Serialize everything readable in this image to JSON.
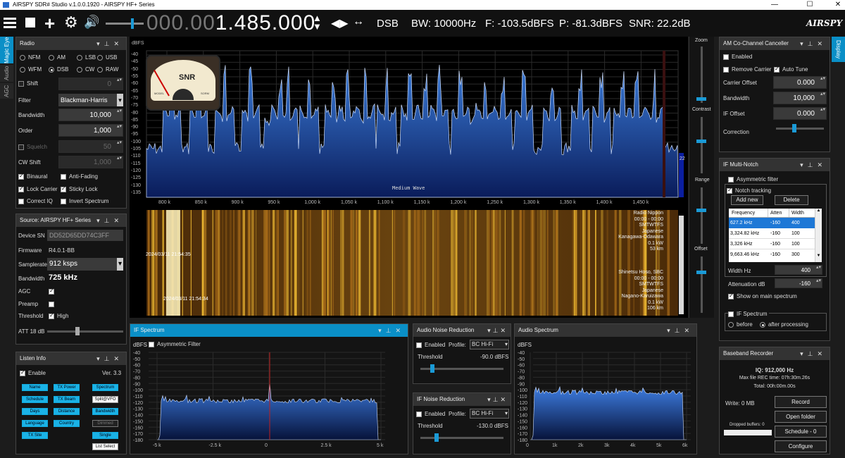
{
  "titlebar": {
    "title": "AIRSPY SDR# Studio v.1.0.0.1920 - AIRSPY HF+ Series",
    "minimize": "—",
    "maximize": "☐",
    "close": "✕"
  },
  "toolbar": {
    "frequency_dim": "000.00",
    "frequency_bright": "1.485.000",
    "mode": "DSB",
    "bw": "BW: 10000Hz",
    "f": "F: -103.5dBFS",
    "p": "P: -81.3dBFS",
    "snr": "SNR: 22.2dB",
    "brand": "AIRSPY"
  },
  "left_tabs": {
    "magic_eye": "Magic Eye",
    "audio": "Audio",
    "agc": "AGC"
  },
  "right_tab": {
    "display": "Display"
  },
  "radio": {
    "title": "Radio",
    "modes": [
      "NFM",
      "AM",
      "LSB",
      "USB",
      "WFM",
      "DSB",
      "CW",
      "RAW"
    ],
    "selected_mode": "DSB",
    "shift_label": "Shift",
    "shift_value": "0",
    "filter_label": "Filter",
    "filter_value": "Blackman-Harris",
    "bandwidth_label": "Bandwidth",
    "bandwidth_value": "10,000",
    "order_label": "Order",
    "order_value": "1,000",
    "squelch_label": "Squelch",
    "squelch_value": "50",
    "cwshift_label": "CW Shift",
    "cwshift_value": "1,000",
    "binaural": "Binaural",
    "anti_fading": "Anti-Fading",
    "lock_carrier": "Lock Carrier",
    "sticky_lock": "Sticky Lock",
    "correct_iq": "Correct IQ",
    "invert_spectrum": "Invert Spectrum"
  },
  "source": {
    "title": "Source: AIRSPY HF+ Series",
    "device_sn_label": "Device SN",
    "device_sn_value": "DD52D65DD74C3FF",
    "firmware_label": "Firmware",
    "firmware_value": "R4.0.1-BB",
    "samplerate_label": "Samplerate",
    "samplerate_value": "912 ksps",
    "bandwidth_label": "Bandwidth",
    "bandwidth_value": "725 kHz",
    "agc_label": "AGC",
    "preamp_label": "Preamp",
    "threshold_label": "Threshold",
    "threshold_value": "High",
    "att_label": "ATT 18 dB"
  },
  "listen": {
    "title": "Listen Info",
    "enable": "Enable",
    "version": "Ver. 3.3",
    "buttons": [
      "Name",
      "TX Power",
      "Spectrum",
      "Schedule",
      "TX Beam",
      "Split@VFO",
      "Days",
      "Distance",
      "Bandwidth",
      "Language",
      "Country",
      "Dimmed",
      "TX Site",
      "",
      "Single",
      "",
      "",
      "List Select"
    ]
  },
  "spectrum": {
    "unit": "dBFS",
    "y_ticks": [
      "-40",
      "-45",
      "-50",
      "-55",
      "-60",
      "-65",
      "-70",
      "-75",
      "-80",
      "-85",
      "-90",
      "-95",
      "-100",
      "-105",
      "-110",
      "-115",
      "-120",
      "-125",
      "-130",
      "-135"
    ],
    "x_ticks": [
      "800 k",
      "850 k",
      "900 k",
      "950 k",
      "1,000 k",
      "1,050 k",
      "1,100 k",
      "1,150 k",
      "1,200 k",
      "1,250 k",
      "1,300 k",
      "1,350 k",
      "1,400 k",
      "1,450 k"
    ],
    "band_label": "Medium Wave",
    "level_value": "22",
    "meter_label": "SNR",
    "meter_left": "MODEL",
    "meter_right": "SORM"
  },
  "waterfall": {
    "ts1": "2024/03/11 21:54:35",
    "ts2": "2024/03/11 21:54:34",
    "station1": [
      "Radio Nippon",
      "00:00 - 00:00",
      "SMTWTFS",
      "Japanese",
      "Kanagawa-Odawara",
      "0.1 kW",
      "53 km"
    ],
    "station2": [
      "Shinetsu Hoso, SBC",
      "00:00 - 00:00",
      "SMTWTFS",
      "Japanese",
      "Nagano-Karuizawa",
      "0.1 kW",
      "106 km"
    ]
  },
  "zoom": {
    "zoom": "Zoom",
    "contrast": "Contrast",
    "range": "Range",
    "offset": "Offset"
  },
  "if_spectrum": {
    "title": "IF Spectrum",
    "asymmetric": "Asymmetric Filter",
    "unit": "dBFS",
    "y_ticks": [
      "-40",
      "-50",
      "-60",
      "-70",
      "-80",
      "-90",
      "-100",
      "-110",
      "-120",
      "-130",
      "-140",
      "-150",
      "-160",
      "-170",
      "-180"
    ],
    "x_ticks": [
      "-5 k",
      "-2.5 k",
      "0",
      "2.5 k",
      "5 k"
    ]
  },
  "audio_nr": {
    "title": "Audio Noise Reduction",
    "enabled": "Enabled",
    "profile_label": "Profile:",
    "profile_value": "BC Hi-Fi",
    "threshold_label": "Threshold",
    "threshold_value": "-90.0 dBFS"
  },
  "if_nr": {
    "title": "IF Noise Reduction",
    "enabled": "Enabled",
    "profile_label": "Profile:",
    "profile_value": "BC Hi-Fi",
    "threshold_label": "Threshold",
    "threshold_value": "-130.0 dBFS"
  },
  "audio_spectrum": {
    "title": "Audio Spectrum",
    "unit": "dBFS",
    "y_ticks": [
      "-40",
      "-50",
      "-60",
      "-70",
      "-80",
      "-90",
      "-100",
      "-110",
      "-120",
      "-130",
      "-140",
      "-150",
      "-160",
      "-170",
      "-180"
    ],
    "x_ticks": [
      "0",
      "1k",
      "2k",
      "3k",
      "4k",
      "5k",
      "6k"
    ]
  },
  "am_cc": {
    "title": "AM Co-Channel Canceller",
    "enabled": "Enabled",
    "remove_carrier": "Remove Carrier",
    "auto_tune": "Auto Tune",
    "carrier_offset_label": "Carrier Offset",
    "carrier_offset_value": "0.000",
    "bandwidth_label": "Bandwidth",
    "bandwidth_value": "10,000",
    "if_offset_label": "IF Offset",
    "if_offset_value": "0.000",
    "correction_label": "Correction"
  },
  "if_mn": {
    "title": "IF Multi-Notch",
    "asymmetric": "Asymmetric filter",
    "notch_tracking": "Notch tracking",
    "add_new": "Add new",
    "delete": "Delete",
    "columns": [
      "Frequency",
      "Atten",
      "Width"
    ],
    "rows": [
      [
        "627.2 kHz",
        "-160",
        "400"
      ],
      [
        "3,324.82 kHz",
        "-160",
        "100"
      ],
      [
        "3,326 kHz",
        "-160",
        "100"
      ],
      [
        "9,663.46 kHz",
        "-160",
        "300"
      ]
    ],
    "width_label": "Width Hz",
    "width_value": "400",
    "atten_label": "Attenuation dB",
    "atten_value": "-160",
    "show_main": "Show on main spectrum",
    "if_spectrum_label": "IF Spectrum",
    "before": "before",
    "after": "after processing"
  },
  "baseband": {
    "title": "Baseband Recorder",
    "iq": "IQ: 912,000 Hz",
    "max_file": "Max file REC time: 07h:30m.26s",
    "total": "Total: 00h:00m.00s",
    "write": "Write: 0 MB",
    "record": "Record",
    "open_folder": "Open folder",
    "schedule": "Schedule - 0",
    "dropped": "Dropped buffers: 0",
    "configure": "Configure"
  }
}
